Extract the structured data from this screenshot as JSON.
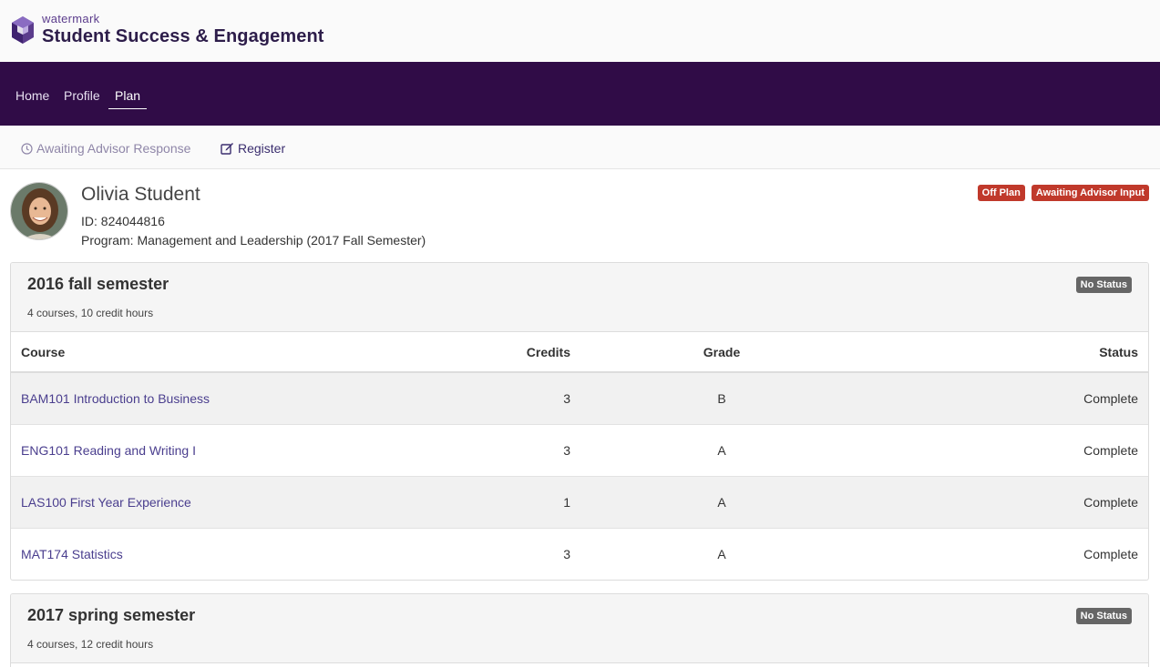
{
  "brand": {
    "small": "watermark",
    "big": "Student Success & Engagement"
  },
  "nav": {
    "items": [
      "Home",
      "Profile",
      "Plan"
    ],
    "active": "Plan"
  },
  "subbar": {
    "awaiting": "Awaiting Advisor Response",
    "register": "Register"
  },
  "student": {
    "name": "Olivia Student",
    "id_text": "ID: 824044816",
    "program_text": "Program: Management and Leadership (2017 Fall Semester)",
    "badges": [
      "Off Plan",
      "Awaiting Advisor Input"
    ]
  },
  "table_headers": {
    "course": "Course",
    "credits": "Credits",
    "grade": "Grade",
    "status": "Status"
  },
  "semesters": [
    {
      "title": "2016 fall semester",
      "summary": "4 courses, 10 credit hours",
      "status": "No Status",
      "courses": [
        {
          "course": "BAM101 Introduction to Business",
          "credits": "3",
          "grade": "B",
          "status": "Complete"
        },
        {
          "course": "ENG101 Reading and Writing I",
          "credits": "3",
          "grade": "A",
          "status": "Complete"
        },
        {
          "course": "LAS100 First Year Experience",
          "credits": "1",
          "grade": "A",
          "status": "Complete"
        },
        {
          "course": "MAT174 Statistics",
          "credits": "3",
          "grade": "A",
          "status": "Complete"
        }
      ]
    },
    {
      "title": "2017 spring semester",
      "summary": "4 courses, 12 credit hours",
      "status": "No Status"
    }
  ],
  "colors": {
    "nav_bg": "#300c47",
    "badge_red": "#c0392b",
    "badge_gray": "#666666",
    "link": "#4a3e8e"
  }
}
